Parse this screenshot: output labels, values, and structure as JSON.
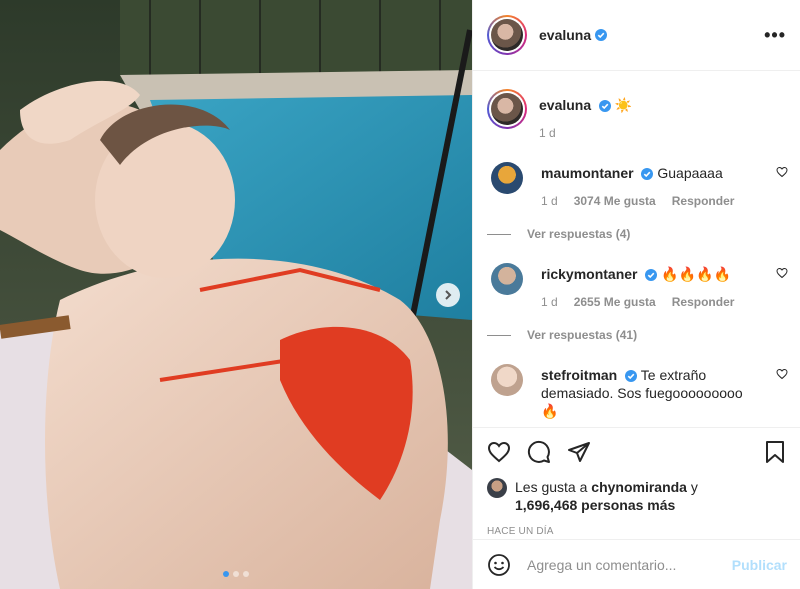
{
  "post": {
    "username": "evaluna",
    "more_label": "•••",
    "carousel_dots": 3,
    "carousel_active": 0
  },
  "caption": {
    "username": "evaluna",
    "emoji": "☀️",
    "time": "1 d"
  },
  "comments": [
    {
      "username": "maumontaner",
      "text": "Guapaaaa",
      "time": "1 d",
      "likes": "3074 Me gusta",
      "reply_label": "Responder",
      "view_replies": "Ver respuestas (4)",
      "avatar_color": "#c8a13a"
    },
    {
      "username": "rickymontaner",
      "text": "🔥🔥🔥🔥",
      "time": "1 d",
      "likes": "2655 Me gusta",
      "reply_label": "Responder",
      "view_replies": "Ver respuestas (41)",
      "avatar_color": "#4a7a9a"
    },
    {
      "username": "stefroitman",
      "text": "Te extraño demasiado. Sos fuegooooooooo 🔥",
      "avatar_color": "#d8c2b4"
    }
  ],
  "likes": {
    "prefix": "Les gusta a ",
    "user": "chynomiranda",
    "conj": " y",
    "count": "1,696,468 personas más"
  },
  "timestamp": "HACE UN DÍA",
  "add_comment": {
    "placeholder": "Agrega un comentario...",
    "publish": "Publicar"
  },
  "colors": {
    "verified": "#3897f0",
    "publish_disabled": "#b2dffc",
    "secondary_text": "#8e8e8e"
  }
}
